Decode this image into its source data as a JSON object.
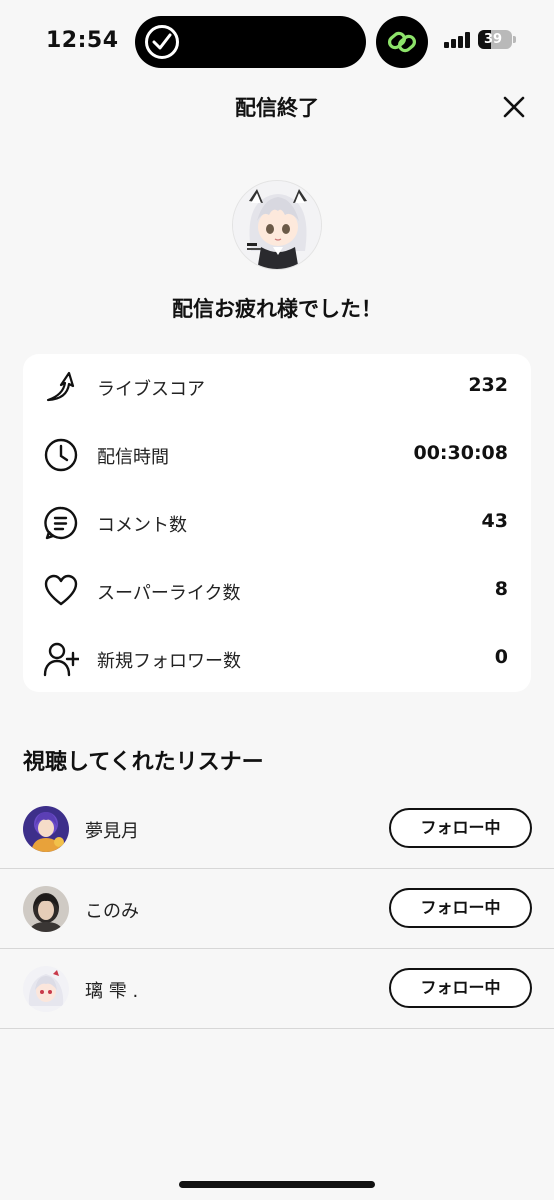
{
  "status_bar": {
    "time": "12:54",
    "battery": "39",
    "battery_level": 0.39
  },
  "header": {
    "title": "配信終了"
  },
  "profile": {
    "message": "配信お疲れ様でした！"
  },
  "stats": [
    {
      "icon": "score-arrow-icon",
      "label": "ライブスコア",
      "value": "232"
    },
    {
      "icon": "clock-icon",
      "label": "配信時間",
      "value": "00:30:08"
    },
    {
      "icon": "comment-icon",
      "label": "コメント数",
      "value": "43"
    },
    {
      "icon": "heart-icon",
      "label": "スーパーライク数",
      "value": "8"
    },
    {
      "icon": "add-user-icon",
      "label": "新規フォロワー数",
      "value": "0"
    }
  ],
  "listeners": {
    "title": "視聴してくれたリスナー",
    "items": [
      {
        "name": "夢見月",
        "button": "フォロー中"
      },
      {
        "name": "このみ",
        "button": "フォロー中"
      },
      {
        "name": "璃 雫 .",
        "button": "フォロー中"
      }
    ]
  },
  "colors": {
    "background": "#f7f7f7",
    "card": "#ffffff",
    "text": "#111111",
    "link_green": "#8de36a"
  }
}
